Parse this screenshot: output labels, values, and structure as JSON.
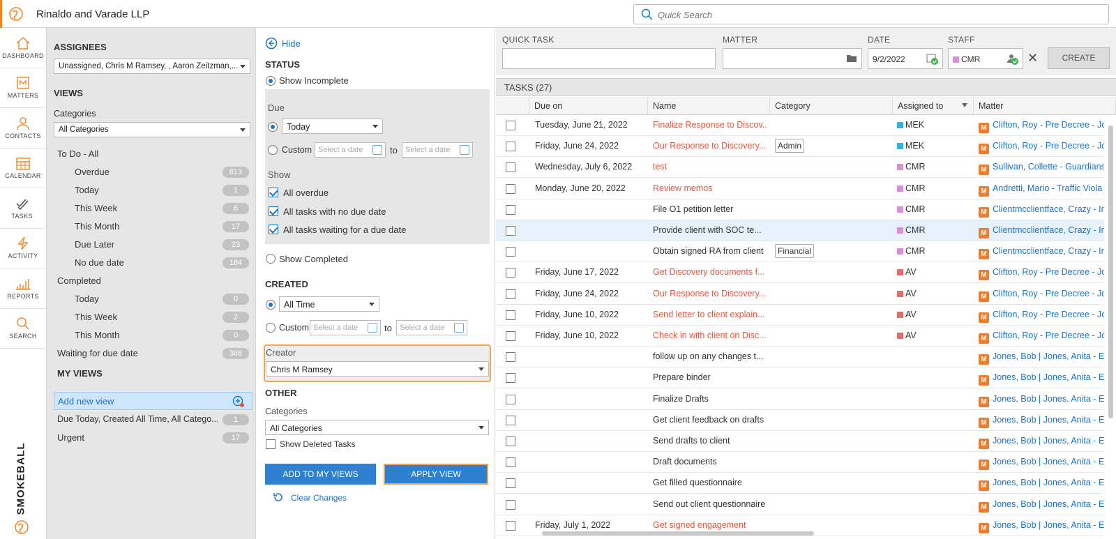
{
  "app": {
    "firm": "Rinaldo and Varade LLP",
    "search_placeholder": "Quick Search"
  },
  "nav": [
    {
      "label": "DASHBOARD",
      "icon": "home-icon"
    },
    {
      "label": "MATTERS",
      "icon": "matters-icon"
    },
    {
      "label": "CONTACTS",
      "icon": "contacts-icon"
    },
    {
      "label": "CALENDAR",
      "icon": "calendar-icon"
    },
    {
      "label": "TASKS",
      "icon": "tasks-icon"
    },
    {
      "label": "ACTIVITY",
      "icon": "activity-icon"
    },
    {
      "label": "REPORTS",
      "icon": "reports-icon"
    },
    {
      "label": "SEARCH",
      "icon": "search-icon"
    }
  ],
  "brand": "SMOKEBALL",
  "views": {
    "assignees_title": "ASSIGNEES",
    "assignees_value": "Unassigned, Chris M Ramsey, , Aaron Zeitzman,...",
    "views_title": "VIEWS",
    "categories_label": "Categories",
    "categories_value": "All Categories",
    "todo_all": "To Do - All",
    "todo": [
      {
        "label": "Overdue",
        "count": "613"
      },
      {
        "label": "Today",
        "count": "1"
      },
      {
        "label": "This Week",
        "count": "6"
      },
      {
        "label": "This Month",
        "count": "17"
      },
      {
        "label": "Due Later",
        "count": "23"
      },
      {
        "label": "No due date",
        "count": "184"
      }
    ],
    "completed": "Completed",
    "completed_items": [
      {
        "label": "Today",
        "count": "0"
      },
      {
        "label": "This Week",
        "count": "2"
      },
      {
        "label": "This Month",
        "count": "0"
      }
    ],
    "waiting": {
      "label": "Waiting for due date",
      "count": "368"
    },
    "my_views_title": "MY VIEWS",
    "add_new_view": "Add new view",
    "my_views": [
      {
        "label": "Due Today, Created All Time, All Catego...",
        "count": "1"
      },
      {
        "label": "Urgent",
        "count": "17"
      }
    ]
  },
  "filters": {
    "hide": "Hide",
    "status_title": "STATUS",
    "show_incomplete": "Show Incomplete",
    "due_label": "Due",
    "due_value": "Today",
    "custom": "Custom",
    "date_placeholder": "Select a date",
    "to": "to",
    "show_label": "Show",
    "all_overdue": "All overdue",
    "no_due": "All tasks with no due date",
    "waiting_due": "All tasks waiting for a due date",
    "show_completed": "Show Completed",
    "created_title": "CREATED",
    "created_value": "All Time",
    "creator_label": "Creator",
    "creator_value": "Chris M Ramsey",
    "other_title": "OTHER",
    "categories_label": "Categories",
    "categories_value": "All Categories",
    "show_deleted": "Show Deleted Tasks",
    "add_to_my_views": "ADD TO MY VIEWS",
    "apply_view": "APPLY VIEW",
    "clear_changes": "Clear Changes"
  },
  "quicktask": {
    "quick_task_label": "QUICK TASK",
    "matter_label": "MATTER",
    "date_label": "DATE",
    "date_value": "9/2/2022",
    "staff_label": "STAFF",
    "staff_value": "CMR",
    "create": "CREATE"
  },
  "tasks": {
    "header": "TASKS (27)",
    "columns": [
      "Due on",
      "Name",
      "Category",
      "Assigned to",
      "Matter"
    ],
    "rows": [
      {
        "due": "Tuesday, June 21, 2022",
        "name": "Finalize Response to Discov...",
        "red": true,
        "category": "",
        "assigned": "MEK",
        "color": "#2bb5e6",
        "matter": "Clifton, Roy - Pre Decree - Jo"
      },
      {
        "due": "Friday, June 24, 2022",
        "name": "Our Response to Discovery...",
        "red": true,
        "category": "Admin",
        "assigned": "MEK",
        "color": "#2bb5e6",
        "matter": "Clifton, Roy - Pre Decree - Jo"
      },
      {
        "due": "Wednesday, July 6, 2022",
        "name": "test",
        "red": true,
        "category": "",
        "assigned": "CMR",
        "color": "#d88fd8",
        "matter": "Sullivan, Collette - Guardians"
      },
      {
        "due": "Monday, June 20, 2022",
        "name": "Review memos",
        "red": true,
        "category": "",
        "assigned": "CMR",
        "color": "#d88fd8",
        "matter": "Andretti, Mario - Traffic Viola"
      },
      {
        "due": "",
        "name": "File O1 petition letter",
        "red": false,
        "category": "",
        "assigned": "CMR",
        "color": "#d88fd8",
        "matter": "Clientmcclientface, Crazy - Im"
      },
      {
        "due": "",
        "name": "Provide client with SOC te...",
        "red": false,
        "category": "",
        "assigned": "CMR",
        "color": "#d88fd8",
        "matter": "Clientmcclientface, Crazy - Im",
        "hl": true
      },
      {
        "due": "",
        "name": "Obtain signed RA from client",
        "red": false,
        "category": "Financial",
        "assigned": "CMR",
        "color": "#d88fd8",
        "matter": "Clientmcclientface, Crazy - Im"
      },
      {
        "due": "Friday, June 17, 2022",
        "name": "Get Discovery documents f...",
        "red": true,
        "category": "",
        "assigned": "AV",
        "color": "#e56b6b",
        "matter": "Clifton, Roy - Pre Decree - Jo"
      },
      {
        "due": "Friday, June 24, 2022",
        "name": "Our Response to Discovery...",
        "red": true,
        "category": "",
        "assigned": "AV",
        "color": "#e56b6b",
        "matter": "Clifton, Roy - Pre Decree - Jo"
      },
      {
        "due": "Friday, June 10, 2022",
        "name": "Send letter to client explain...",
        "red": true,
        "category": "",
        "assigned": "AV",
        "color": "#e56b6b",
        "matter": "Clifton, Roy - Pre Decree - Jo"
      },
      {
        "due": "Friday, June 10, 2022",
        "name": "Check in with client on Disc...",
        "red": true,
        "category": "",
        "assigned": "AV",
        "color": "#e56b6b",
        "matter": "Clifton, Roy - Pre Decree - Jo"
      },
      {
        "due": "",
        "name": "follow up on any changes t...",
        "red": false,
        "category": "",
        "assigned": "",
        "color": "",
        "matter": "Jones, Bob | Jones, Anita - Es"
      },
      {
        "due": "",
        "name": "Prepare binder",
        "red": false,
        "category": "",
        "assigned": "",
        "color": "",
        "matter": "Jones, Bob | Jones, Anita - Es"
      },
      {
        "due": "",
        "name": "Finalize Drafts",
        "red": false,
        "category": "",
        "assigned": "",
        "color": "",
        "matter": "Jones, Bob | Jones, Anita - Es"
      },
      {
        "due": "",
        "name": "Get client feedback on drafts",
        "red": false,
        "category": "",
        "assigned": "",
        "color": "",
        "matter": "Jones, Bob | Jones, Anita - Es"
      },
      {
        "due": "",
        "name": "Send drafts to client",
        "red": false,
        "category": "",
        "assigned": "",
        "color": "",
        "matter": "Jones, Bob | Jones, Anita - Es"
      },
      {
        "due": "",
        "name": "Draft documents",
        "red": false,
        "category": "",
        "assigned": "",
        "color": "",
        "matter": "Jones, Bob | Jones, Anita - Es"
      },
      {
        "due": "",
        "name": "Get filled questionnaire",
        "red": false,
        "category": "",
        "assigned": "",
        "color": "",
        "matter": "Jones, Bob | Jones, Anita - Es"
      },
      {
        "due": "",
        "name": "Send out client questionnaire",
        "red": false,
        "category": "",
        "assigned": "",
        "color": "",
        "matter": "Jones, Bob | Jones, Anita - Es"
      },
      {
        "due": "Friday, July 1, 2022",
        "name": "Get signed engagement",
        "red": true,
        "category": "",
        "assigned": "",
        "color": "",
        "matter": "Jones, Bob | Jones, Anita - Es"
      }
    ]
  },
  "colors": {
    "accent": "#f58220",
    "link": "#1a73c8",
    "overdue": "#e8533a"
  }
}
